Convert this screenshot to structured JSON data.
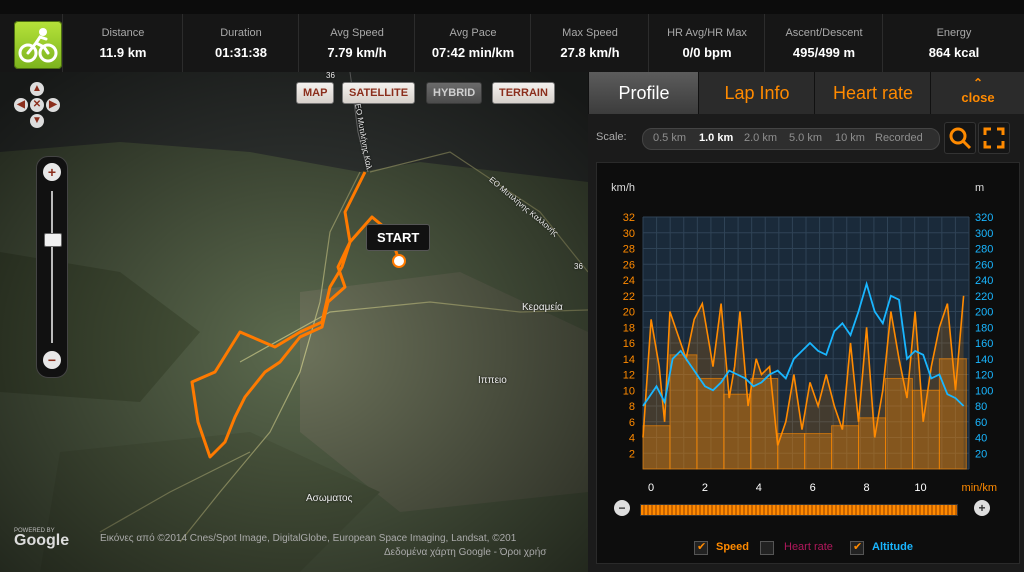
{
  "stats": [
    {
      "label": "Distance",
      "value": "11.9 km"
    },
    {
      "label": "Duration",
      "value": "01:31:38"
    },
    {
      "label": "Avg Speed",
      "value": "7.79 km/h"
    },
    {
      "label": "Avg Pace",
      "value": "07:42 min/km"
    },
    {
      "label": "Max Speed",
      "value": "27.8 km/h"
    },
    {
      "label": "HR Avg/HR Max",
      "value": "0/0 bpm"
    },
    {
      "label": "Ascent/Descent",
      "value": "495/499 m"
    },
    {
      "label": "Energy",
      "value": "864 kcal"
    }
  ],
  "map": {
    "buttons": [
      "MAP",
      "SATELLITE",
      "HYBRID",
      "TERRAIN"
    ],
    "active_button": "HYBRID",
    "start_label": "START",
    "places": [
      "Κεραμεία",
      "Ιππειο",
      "Ασωματος"
    ],
    "road_labels": [
      "36",
      "36",
      "ΕΟ Μυτιλήνης Καλλονής",
      "ΕΟ Μυτιλήνης Καλ"
    ],
    "powered_by": "POWERED BY",
    "google": "Google",
    "credits_line1": "Εικόνες από ©2014 Cnes/Spot Image, DigitalGlobe, European Space Imaging, Landsat, ©201",
    "credits_line2": "Δεδομένα χάρτη Google - Όροι χρήσ"
  },
  "panel": {
    "tabs": [
      "Profile",
      "Lap Info",
      "Heart rate"
    ],
    "close_label": "close",
    "scale_label": "Scale:",
    "scale_options": [
      "0.5 km",
      "1.0 km",
      "2.0 km",
      "5.0 km",
      "10 km",
      "Recorded"
    ],
    "selected_scale": "1.0 km",
    "legend": [
      {
        "label": "Speed",
        "checked": true,
        "color": "#ff8a00"
      },
      {
        "label": "Heart rate",
        "checked": false,
        "color": "#b0185c"
      },
      {
        "label": "Altitude",
        "checked": true,
        "color": "#19b6ff"
      }
    ],
    "colors": {
      "speed": "#ff8a00",
      "altitude": "#19b6ff"
    }
  },
  "chart_data": {
    "type": "line",
    "left_unit": "km/h",
    "right_unit": "m",
    "x_unit": "min/km",
    "x_ticks": [
      0,
      2,
      4,
      6,
      8,
      10
    ],
    "x_range": [
      -0.3,
      11.8
    ],
    "y_left_ticks": [
      2,
      4,
      6,
      8,
      10,
      12,
      14,
      16,
      18,
      20,
      22,
      24,
      26,
      28,
      30,
      32
    ],
    "y_right_ticks": [
      20,
      40,
      60,
      80,
      100,
      120,
      140,
      160,
      180,
      200,
      220,
      240,
      260,
      280,
      300,
      320
    ],
    "y_left_range": [
      0,
      32
    ],
    "y_right_range": [
      0,
      320
    ],
    "speed_bars": [
      {
        "x0": -0.3,
        "x1": 0.7,
        "value": 5.5
      },
      {
        "x0": 0.7,
        "x1": 1.7,
        "value": 14.5
      },
      {
        "x0": 1.7,
        "x1": 2.7,
        "value": 11.5
      },
      {
        "x0": 2.7,
        "x1": 3.7,
        "value": 9.5
      },
      {
        "x0": 3.7,
        "x1": 4.7,
        "value": 11.5
      },
      {
        "x0": 4.7,
        "x1": 5.7,
        "value": 4.5
      },
      {
        "x0": 5.7,
        "x1": 6.7,
        "value": 4.5
      },
      {
        "x0": 6.7,
        "x1": 7.7,
        "value": 5.5
      },
      {
        "x0": 7.7,
        "x1": 8.7,
        "value": 6.5
      },
      {
        "x0": 8.7,
        "x1": 9.7,
        "value": 11.5
      },
      {
        "x0": 9.7,
        "x1": 10.7,
        "value": 10
      },
      {
        "x0": 10.7,
        "x1": 11.7,
        "value": 14
      }
    ],
    "series": [
      {
        "name": "Speed",
        "color": "#ff8a00",
        "x": [
          -0.3,
          0,
          0.3,
          0.5,
          0.7,
          1.0,
          1.3,
          1.6,
          1.9,
          2.1,
          2.3,
          2.6,
          2.9,
          3.1,
          3.3,
          3.6,
          3.9,
          4.1,
          4.4,
          4.7,
          5.0,
          5.3,
          5.6,
          5.9,
          6.2,
          6.5,
          6.8,
          7.1,
          7.4,
          7.7,
          8.0,
          8.3,
          8.6,
          8.9,
          9.2,
          9.5,
          9.8,
          10.1,
          10.4,
          10.7,
          11.0,
          11.3,
          11.6
        ],
        "y": [
          4,
          19,
          13,
          6,
          20,
          17,
          14,
          19,
          21,
          17,
          13,
          21,
          9,
          13,
          20,
          8,
          14,
          12,
          13,
          3,
          6,
          12,
          5,
          11,
          8,
          12,
          8,
          5,
          16,
          6,
          18,
          4,
          10,
          20,
          14,
          9,
          20,
          6,
          13,
          18,
          21,
          10,
          22
        ]
      },
      {
        "name": "Altitude",
        "color": "#19b6ff",
        "x": [
          -0.3,
          0.2,
          0.5,
          0.8,
          1.1,
          1.4,
          1.7,
          2.0,
          2.3,
          2.6,
          2.9,
          3.2,
          3.5,
          3.8,
          4.1,
          4.4,
          4.7,
          5.0,
          5.3,
          5.6,
          5.9,
          6.2,
          6.5,
          6.8,
          7.1,
          7.4,
          7.7,
          8.0,
          8.3,
          8.6,
          8.9,
          9.2,
          9.5,
          9.8,
          10.1,
          10.4,
          10.7,
          11.0,
          11.3,
          11.6
        ],
        "y": [
          80,
          105,
          85,
          140,
          150,
          135,
          120,
          105,
          100,
          110,
          125,
          120,
          115,
          105,
          110,
          120,
          125,
          115,
          140,
          150,
          160,
          150,
          145,
          175,
          185,
          170,
          200,
          235,
          200,
          185,
          220,
          215,
          140,
          150,
          145,
          115,
          120,
          95,
          90,
          80
        ]
      }
    ]
  }
}
